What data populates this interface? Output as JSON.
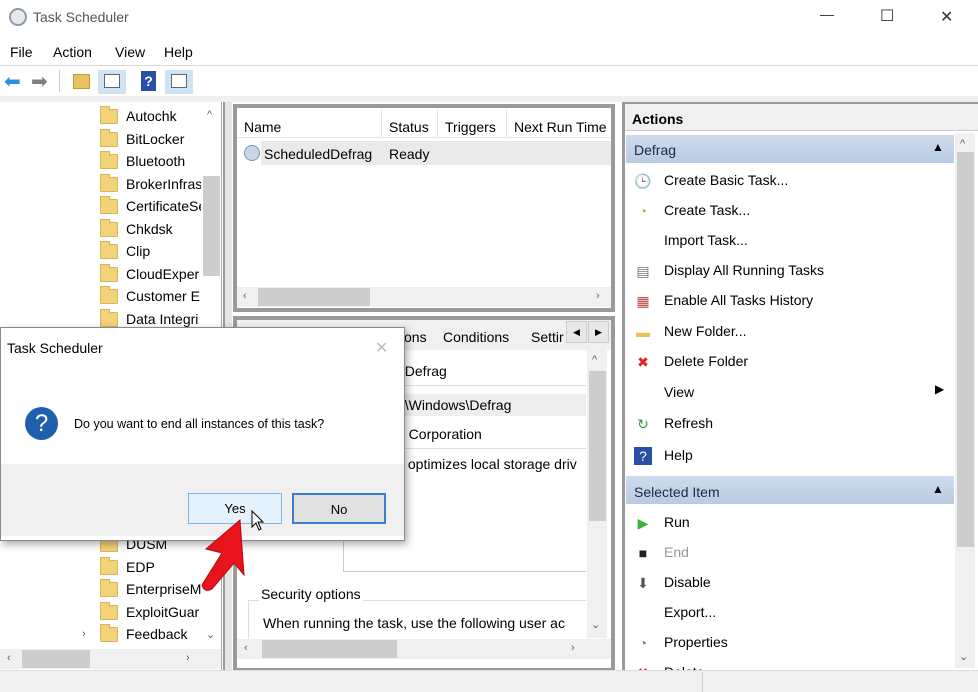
{
  "window": {
    "title": "Task Scheduler",
    "minimize": "—",
    "maximize": "☐",
    "close": "✕"
  },
  "menu": [
    "File",
    "Action",
    "View",
    "Help"
  ],
  "toolbar": {
    "icons": [
      "back-arrow-icon",
      "forward-arrow-icon",
      "folder-up-icon",
      "show-hide-console-tree-icon",
      "help-icon",
      "show-hide-action-pane-icon"
    ]
  },
  "tree": {
    "items": [
      "Autochk",
      "BitLocker",
      "Bluetooth",
      "BrokerInfras",
      "CertificateSe",
      "Chkdsk",
      "Clip",
      "CloudExper",
      "Customer E:",
      "Data Integri"
    ],
    "items_lower": [
      "DUSM",
      "EDP",
      "EnterpriseM",
      "ExploitGuar",
      "Feedback"
    ]
  },
  "task_list": {
    "columns": [
      "Name",
      "Status",
      "Triggers",
      "Next Run Time"
    ],
    "rows": [
      {
        "name": "ScheduledDefrag",
        "status": "Ready"
      }
    ]
  },
  "details": {
    "tabs": [
      "ons",
      "Conditions",
      "Settir"
    ],
    "name_value": "dDefrag",
    "location_value": "ft\\Windows\\Defrag",
    "author_value": "ft Corporation",
    "description_value": "k optimizes local storage driv",
    "security_label": "Security options",
    "security_text": "When running the task, use the following user ac"
  },
  "actions": {
    "title": "Actions",
    "section1": "Defrag",
    "items1": [
      {
        "label": "Create Basic Task...",
        "icon": "create-basic-task-icon"
      },
      {
        "label": "Create Task...",
        "icon": "create-task-icon"
      },
      {
        "label": "Import Task...",
        "icon": ""
      },
      {
        "label": "Display All Running Tasks",
        "icon": "running-tasks-icon"
      },
      {
        "label": "Enable All Tasks History",
        "icon": "history-icon"
      },
      {
        "label": "New Folder...",
        "icon": "new-folder-icon"
      },
      {
        "label": "Delete Folder",
        "icon": "delete-icon"
      },
      {
        "label": "View",
        "icon": ""
      },
      {
        "label": "Refresh",
        "icon": "refresh-icon"
      },
      {
        "label": "Help",
        "icon": "help-icon"
      }
    ],
    "section2": "Selected Item",
    "items2": [
      {
        "label": "Run",
        "icon": "run-icon"
      },
      {
        "label": "End",
        "icon": "end-icon",
        "disabled": true
      },
      {
        "label": "Disable",
        "icon": "disable-icon"
      },
      {
        "label": "Export...",
        "icon": ""
      },
      {
        "label": "Properties",
        "icon": "properties-icon"
      },
      {
        "label": "Delete",
        "icon": "delete-icon"
      }
    ]
  },
  "dialog": {
    "title": "Task Scheduler",
    "message": "Do you want to end all instances of this task?",
    "yes": "Yes",
    "no": "No",
    "close": "✕"
  },
  "colors": {
    "header_blue": "#bccfe6",
    "annotation_arrow": "#e8141c",
    "dialog_icon": "#1f5fae"
  }
}
